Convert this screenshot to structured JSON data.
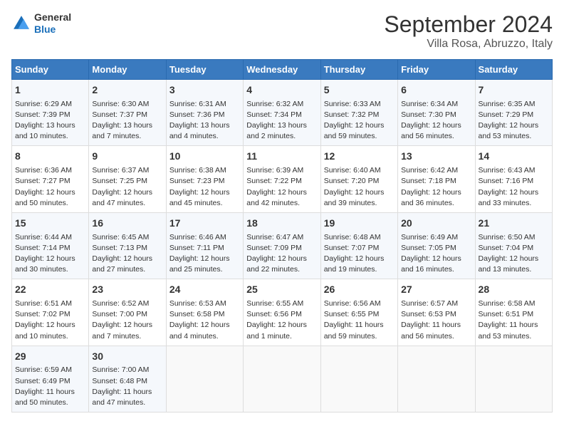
{
  "header": {
    "logo_line1": "General",
    "logo_line2": "Blue",
    "title": "September 2024",
    "subtitle": "Villa Rosa, Abruzzo, Italy"
  },
  "calendar": {
    "days_of_week": [
      "Sunday",
      "Monday",
      "Tuesday",
      "Wednesday",
      "Thursday",
      "Friday",
      "Saturday"
    ],
    "weeks": [
      [
        {
          "day": "1",
          "sunrise": "6:29 AM",
          "sunset": "7:39 PM",
          "daylight": "13 hours and 10 minutes."
        },
        {
          "day": "2",
          "sunrise": "6:30 AM",
          "sunset": "7:37 PM",
          "daylight": "13 hours and 7 minutes."
        },
        {
          "day": "3",
          "sunrise": "6:31 AM",
          "sunset": "7:36 PM",
          "daylight": "13 hours and 4 minutes."
        },
        {
          "day": "4",
          "sunrise": "6:32 AM",
          "sunset": "7:34 PM",
          "daylight": "13 hours and 2 minutes."
        },
        {
          "day": "5",
          "sunrise": "6:33 AM",
          "sunset": "7:32 PM",
          "daylight": "12 hours and 59 minutes."
        },
        {
          "day": "6",
          "sunrise": "6:34 AM",
          "sunset": "7:30 PM",
          "daylight": "12 hours and 56 minutes."
        },
        {
          "day": "7",
          "sunrise": "6:35 AM",
          "sunset": "7:29 PM",
          "daylight": "12 hours and 53 minutes."
        }
      ],
      [
        {
          "day": "8",
          "sunrise": "6:36 AM",
          "sunset": "7:27 PM",
          "daylight": "12 hours and 50 minutes."
        },
        {
          "day": "9",
          "sunrise": "6:37 AM",
          "sunset": "7:25 PM",
          "daylight": "12 hours and 47 minutes."
        },
        {
          "day": "10",
          "sunrise": "6:38 AM",
          "sunset": "7:23 PM",
          "daylight": "12 hours and 45 minutes."
        },
        {
          "day": "11",
          "sunrise": "6:39 AM",
          "sunset": "7:22 PM",
          "daylight": "12 hours and 42 minutes."
        },
        {
          "day": "12",
          "sunrise": "6:40 AM",
          "sunset": "7:20 PM",
          "daylight": "12 hours and 39 minutes."
        },
        {
          "day": "13",
          "sunrise": "6:42 AM",
          "sunset": "7:18 PM",
          "daylight": "12 hours and 36 minutes."
        },
        {
          "day": "14",
          "sunrise": "6:43 AM",
          "sunset": "7:16 PM",
          "daylight": "12 hours and 33 minutes."
        }
      ],
      [
        {
          "day": "15",
          "sunrise": "6:44 AM",
          "sunset": "7:14 PM",
          "daylight": "12 hours and 30 minutes."
        },
        {
          "day": "16",
          "sunrise": "6:45 AM",
          "sunset": "7:13 PM",
          "daylight": "12 hours and 27 minutes."
        },
        {
          "day": "17",
          "sunrise": "6:46 AM",
          "sunset": "7:11 PM",
          "daylight": "12 hours and 25 minutes."
        },
        {
          "day": "18",
          "sunrise": "6:47 AM",
          "sunset": "7:09 PM",
          "daylight": "12 hours and 22 minutes."
        },
        {
          "day": "19",
          "sunrise": "6:48 AM",
          "sunset": "7:07 PM",
          "daylight": "12 hours and 19 minutes."
        },
        {
          "day": "20",
          "sunrise": "6:49 AM",
          "sunset": "7:05 PM",
          "daylight": "12 hours and 16 minutes."
        },
        {
          "day": "21",
          "sunrise": "6:50 AM",
          "sunset": "7:04 PM",
          "daylight": "12 hours and 13 minutes."
        }
      ],
      [
        {
          "day": "22",
          "sunrise": "6:51 AM",
          "sunset": "7:02 PM",
          "daylight": "12 hours and 10 minutes."
        },
        {
          "day": "23",
          "sunrise": "6:52 AM",
          "sunset": "7:00 PM",
          "daylight": "12 hours and 7 minutes."
        },
        {
          "day": "24",
          "sunrise": "6:53 AM",
          "sunset": "6:58 PM",
          "daylight": "12 hours and 4 minutes."
        },
        {
          "day": "25",
          "sunrise": "6:55 AM",
          "sunset": "6:56 PM",
          "daylight": "12 hours and 1 minute."
        },
        {
          "day": "26",
          "sunrise": "6:56 AM",
          "sunset": "6:55 PM",
          "daylight": "11 hours and 59 minutes."
        },
        {
          "day": "27",
          "sunrise": "6:57 AM",
          "sunset": "6:53 PM",
          "daylight": "11 hours and 56 minutes."
        },
        {
          "day": "28",
          "sunrise": "6:58 AM",
          "sunset": "6:51 PM",
          "daylight": "11 hours and 53 minutes."
        }
      ],
      [
        {
          "day": "29",
          "sunrise": "6:59 AM",
          "sunset": "6:49 PM",
          "daylight": "11 hours and 50 minutes."
        },
        {
          "day": "30",
          "sunrise": "7:00 AM",
          "sunset": "6:48 PM",
          "daylight": "11 hours and 47 minutes."
        },
        null,
        null,
        null,
        null,
        null
      ]
    ]
  }
}
